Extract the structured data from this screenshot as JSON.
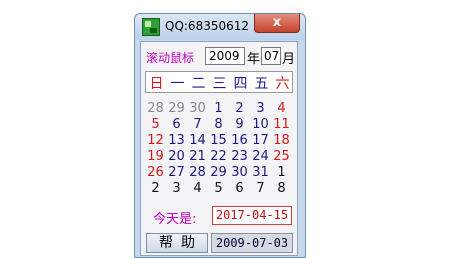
{
  "window": {
    "title": "QQ:68350612",
    "close_glyph": "x"
  },
  "nav": {
    "label": "滚动鼠标",
    "year": "2009",
    "year_unit": "年",
    "month": "07",
    "month_unit": "月"
  },
  "weekdays": [
    "日",
    "一",
    "二",
    "三",
    "四",
    "五",
    "六"
  ],
  "calendar": {
    "weeks": [
      [
        "28",
        "29",
        "30",
        "1",
        "2",
        "3",
        "4"
      ],
      [
        "5",
        "6",
        "7",
        "8",
        "9",
        "10",
        "11"
      ],
      [
        "12",
        "13",
        "14",
        "15",
        "16",
        "17",
        "18"
      ],
      [
        "19",
        "20",
        "21",
        "22",
        "23",
        "24",
        "25"
      ],
      [
        "26",
        "27",
        "28",
        "29",
        "30",
        "31",
        "1"
      ],
      [
        "2",
        "3",
        "4",
        "5",
        "6",
        "7",
        "8"
      ]
    ]
  },
  "today": {
    "label": "今天是:",
    "value": "2017-04-15"
  },
  "footer": {
    "help_label": "帮助",
    "selected_date": "2009-07-03"
  },
  "colors": {
    "sunday_saturday": "#d41a1a",
    "weekday": "#1a1a80",
    "other_month": "#8a8a8a",
    "label_magenta": "#c000c0"
  }
}
